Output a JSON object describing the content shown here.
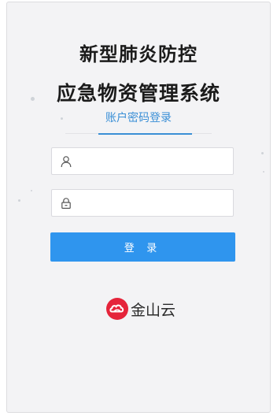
{
  "header": {
    "title_line1": "新型肺炎防控",
    "title_line2": "应急物资管理系统"
  },
  "login": {
    "tab_label": "账户密码登录",
    "username": {
      "placeholder": "",
      "value": "",
      "icon": "user-icon"
    },
    "password": {
      "placeholder": "",
      "value": "",
      "icon": "lock-icon"
    },
    "submit_label": "登 录"
  },
  "brand": {
    "name": "金山云",
    "logo_icon": "kingsoft-cloud-logo"
  },
  "colors": {
    "accent": "#2f95ee",
    "tab_text": "#3a8fd6",
    "logo_red": "#e5243a"
  }
}
